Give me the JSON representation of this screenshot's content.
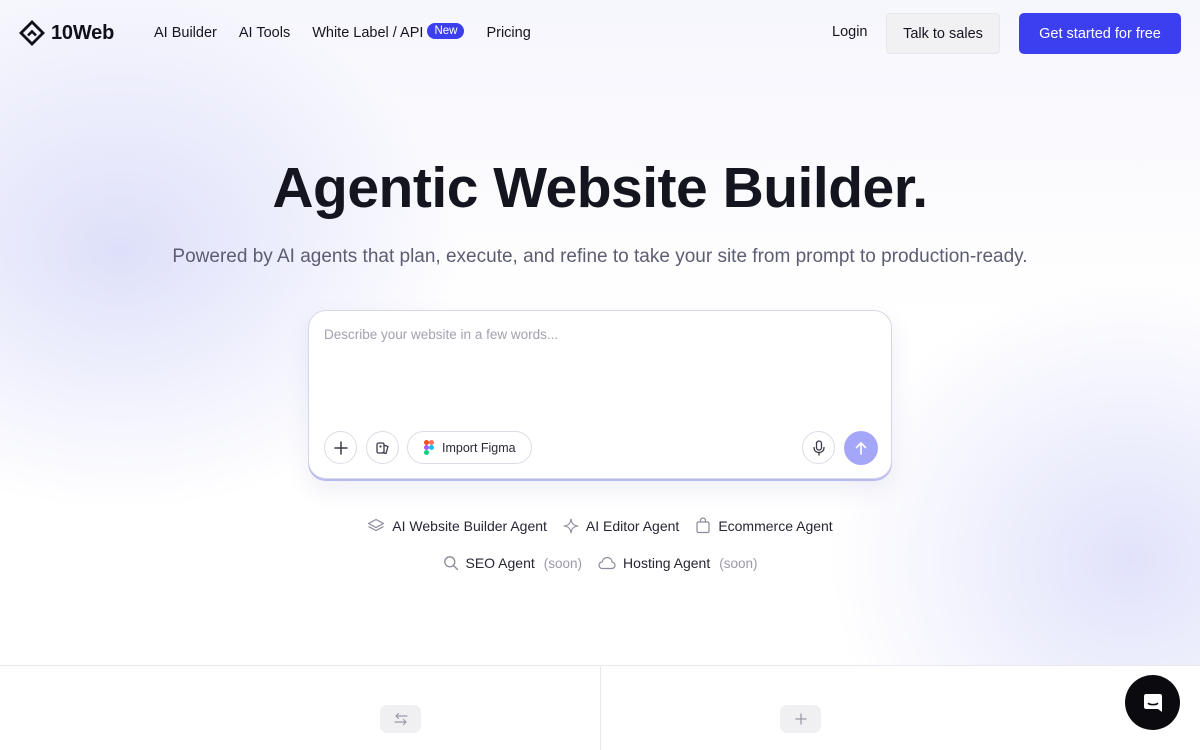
{
  "header": {
    "logo_text": "10Web",
    "nav": {
      "ai_builder": "AI Builder",
      "ai_tools": "AI Tools",
      "white_label": "White Label / API",
      "new_badge": "New",
      "pricing": "Pricing"
    },
    "login": "Login",
    "talk_to_sales": "Talk to sales",
    "get_started": "Get started for free"
  },
  "hero": {
    "title": "Agentic Website Builder.",
    "subtitle": "Powered by AI agents that plan, execute, and refine to take your site from prompt to production-ready."
  },
  "prompt": {
    "placeholder": "Describe your website in a few words...",
    "import_figma": "Import Figma"
  },
  "agents": {
    "row1": [
      {
        "label": "AI Website Builder Agent",
        "icon": "layers-icon"
      },
      {
        "label": "AI Editor Agent",
        "icon": "sparkle-icon"
      },
      {
        "label": "Ecommerce Agent",
        "icon": "shopping-bag-icon"
      }
    ],
    "row2": [
      {
        "label": "SEO Agent",
        "soon": "(soon)",
        "icon": "search-icon"
      },
      {
        "label": "Hosting Agent",
        "soon": "(soon)",
        "icon": "cloud-icon"
      }
    ]
  },
  "colors": {
    "accent": "#3b3ff0",
    "send_button": "#a4a7f7",
    "text_dark": "#15151f",
    "text_muted": "#5d5d72"
  }
}
